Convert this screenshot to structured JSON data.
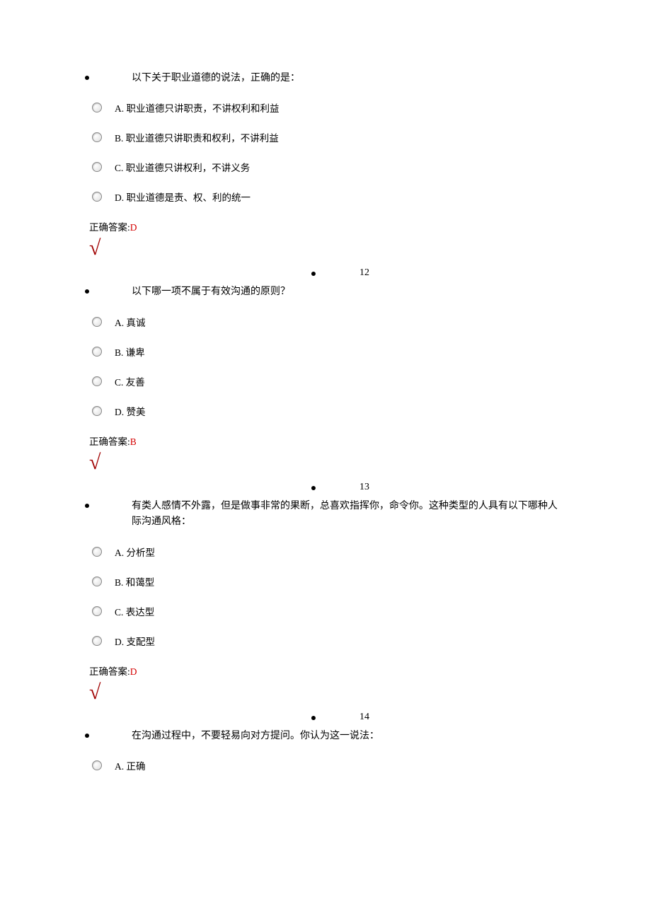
{
  "answer_prefix": "正确答案:",
  "check_symbol": "√",
  "questions": [
    {
      "number": "",
      "text": "以下关于职业道德的说法，正确的是：",
      "options": [
        "A. 职业道德只讲职责，不讲权利和利益",
        "B. 职业道德只讲职责和权利，不讲利益",
        "C. 职业道德只讲权利，不讲义务",
        "D. 职业道德是责、权、利的统一"
      ],
      "answer": "D"
    },
    {
      "number": "12",
      "text": "以下哪一项不属于有效沟通的原则？",
      "options": [
        "A. 真诚",
        "B. 谦卑",
        "C. 友善",
        "D. 赞美"
      ],
      "answer": "B"
    },
    {
      "number": "13",
      "text": "有类人感情不外露，但是做事非常的果断，总喜欢指挥你，命令你。这种类型的人具有以下哪种人际沟通风格：",
      "options": [
        "A. 分析型",
        "B. 和蔼型",
        "C. 表达型",
        "D. 支配型"
      ],
      "answer": "D"
    },
    {
      "number": "14",
      "text": "在沟通过程中，不要轻易向对方提问。你认为这一说法：",
      "options": [
        "A. 正确"
      ],
      "answer": ""
    }
  ]
}
